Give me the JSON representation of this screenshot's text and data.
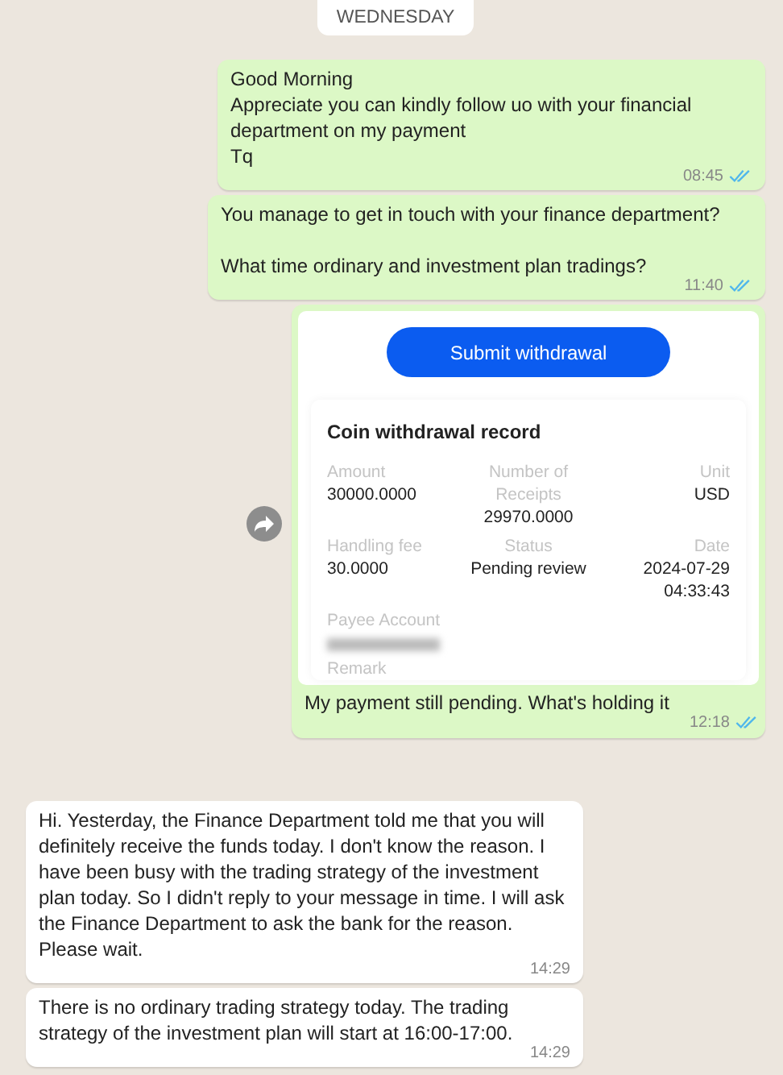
{
  "date_chip": "WEDNESDAY",
  "messages": [
    {
      "kind": "text",
      "outgoing": true,
      "paragraphs": [
        "Good Morning",
        "Appreciate you can kindly follow uo with your financial department on my payment",
        "Tq"
      ],
      "time": "08:45",
      "read": true
    },
    {
      "kind": "text",
      "outgoing": true,
      "blank_line_between": true,
      "paragraphs": [
        "You manage to get in touch with your finance department?",
        "What time ordinary and investment plan tradings?"
      ],
      "time": "11:40",
      "read": true
    },
    {
      "kind": "image",
      "outgoing": true,
      "forward": true,
      "screenshot": {
        "button": "Submit withdrawal",
        "record_title": "Coin withdrawal record",
        "fields": [
          {
            "label": "Amount",
            "value": "30000.0000"
          },
          {
            "label": "Number of Receipts",
            "value": "29970.0000"
          },
          {
            "label": "Unit",
            "value": "USD"
          },
          {
            "label": "Handling fee",
            "value": "30.0000"
          },
          {
            "label": "Status",
            "value": "Pending review"
          },
          {
            "label": "Date",
            "value": "2024-07-29 04:33:43"
          },
          {
            "label": "Payee Account",
            "redacted": true
          }
        ],
        "remark_label": "Remark"
      },
      "caption": "My payment still pending. What's holding it",
      "time": "12:18",
      "read": true
    },
    {
      "kind": "text",
      "outgoing": false,
      "paragraphs": [
        "Hi. Yesterday, the Finance Department told me that you will definitely receive the funds today. I don't know the reason. I have been busy with the trading strategy of the investment plan today. So I didn't reply to your message in time. I will ask the Finance Department to ask the bank for the reason. Please wait."
      ],
      "time": "14:29"
    },
    {
      "kind": "text",
      "outgoing": false,
      "paragraphs": [
        "There is no ordinary trading strategy today. The trading strategy of the investment plan will start at 16:00-17:00."
      ],
      "time": "14:29"
    }
  ]
}
